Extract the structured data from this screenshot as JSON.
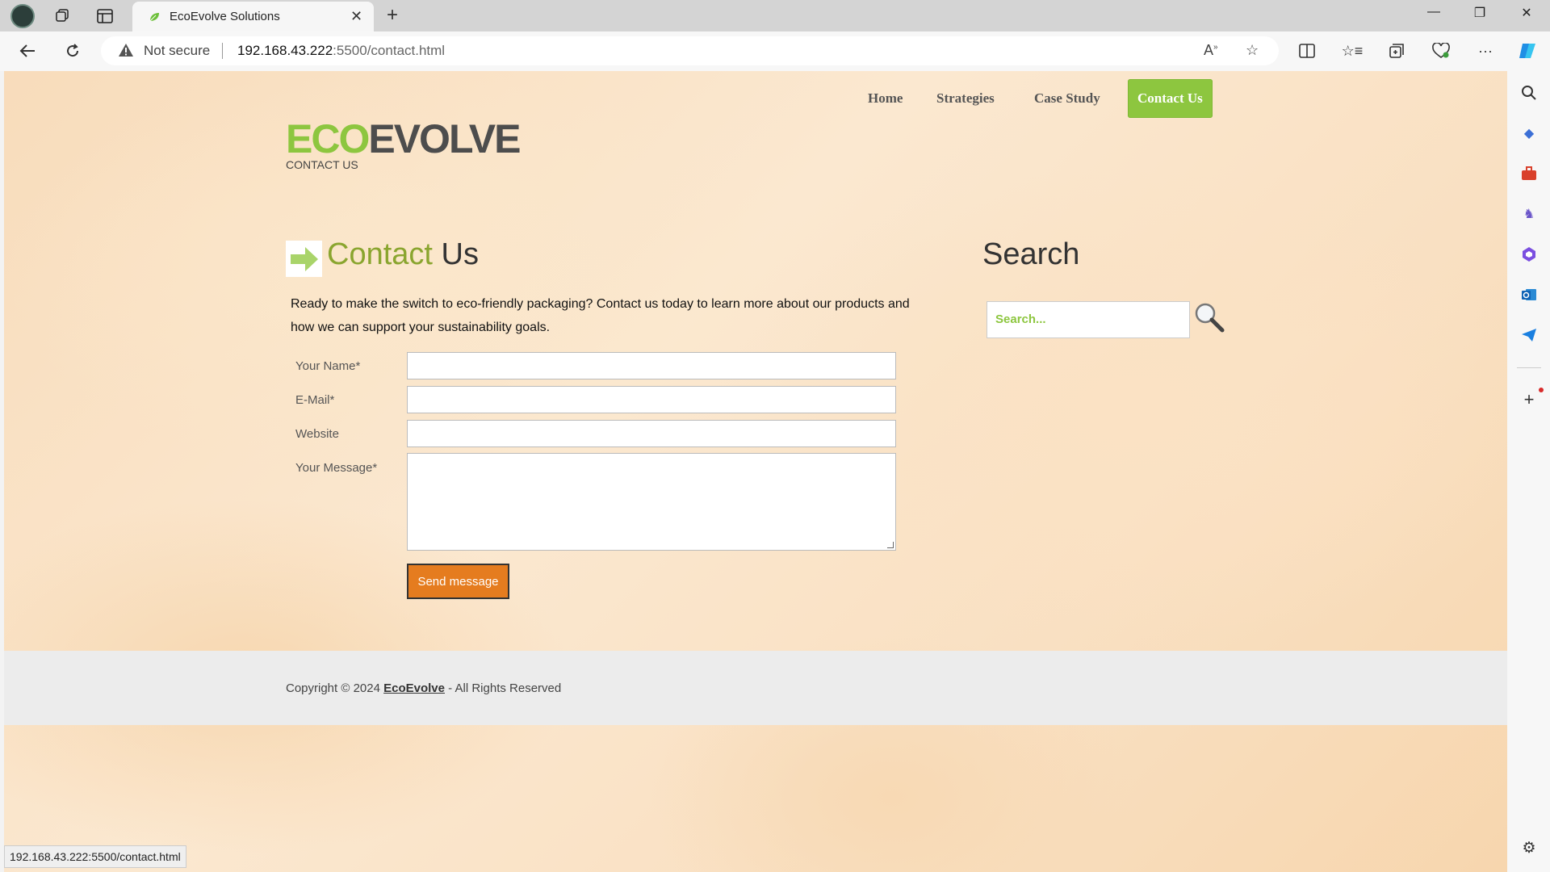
{
  "browser": {
    "tab_title": "EcoEvolve Solutions",
    "not_secure": "Not secure",
    "url_host": "192.168.43.222",
    "url_rest": ":5500/contact.html",
    "status_url": "192.168.43.222:5500/contact.html"
  },
  "nav": {
    "items": [
      {
        "label": "Home"
      },
      {
        "label": "Strategies"
      },
      {
        "label": "Case Study"
      },
      {
        "label": "Contact Us"
      }
    ]
  },
  "logo": {
    "eco": "ECO",
    "evolve": "EVOLVE"
  },
  "header": {
    "subtitle": "CONTACT US"
  },
  "main": {
    "heading_green": "Contact",
    "heading_dark": "Us",
    "intro": "Ready to make the switch to eco-friendly packaging? Contact us today to learn more about our products and how we can support your sustainability goals.",
    "form": {
      "name_label": "Your Name*",
      "email_label": "E-Mail*",
      "website_label": "Website",
      "message_label": "Your Message*",
      "send_label": "Send message"
    }
  },
  "search": {
    "heading": "Search",
    "placeholder": "Search..."
  },
  "footer": {
    "prefix": "Copyright © 2024 ",
    "brand": "EcoEvolve",
    "suffix": " - All Rights Reserved"
  },
  "colors": {
    "accent_green": "#8dc63f",
    "button_orange": "#e57c1f"
  }
}
